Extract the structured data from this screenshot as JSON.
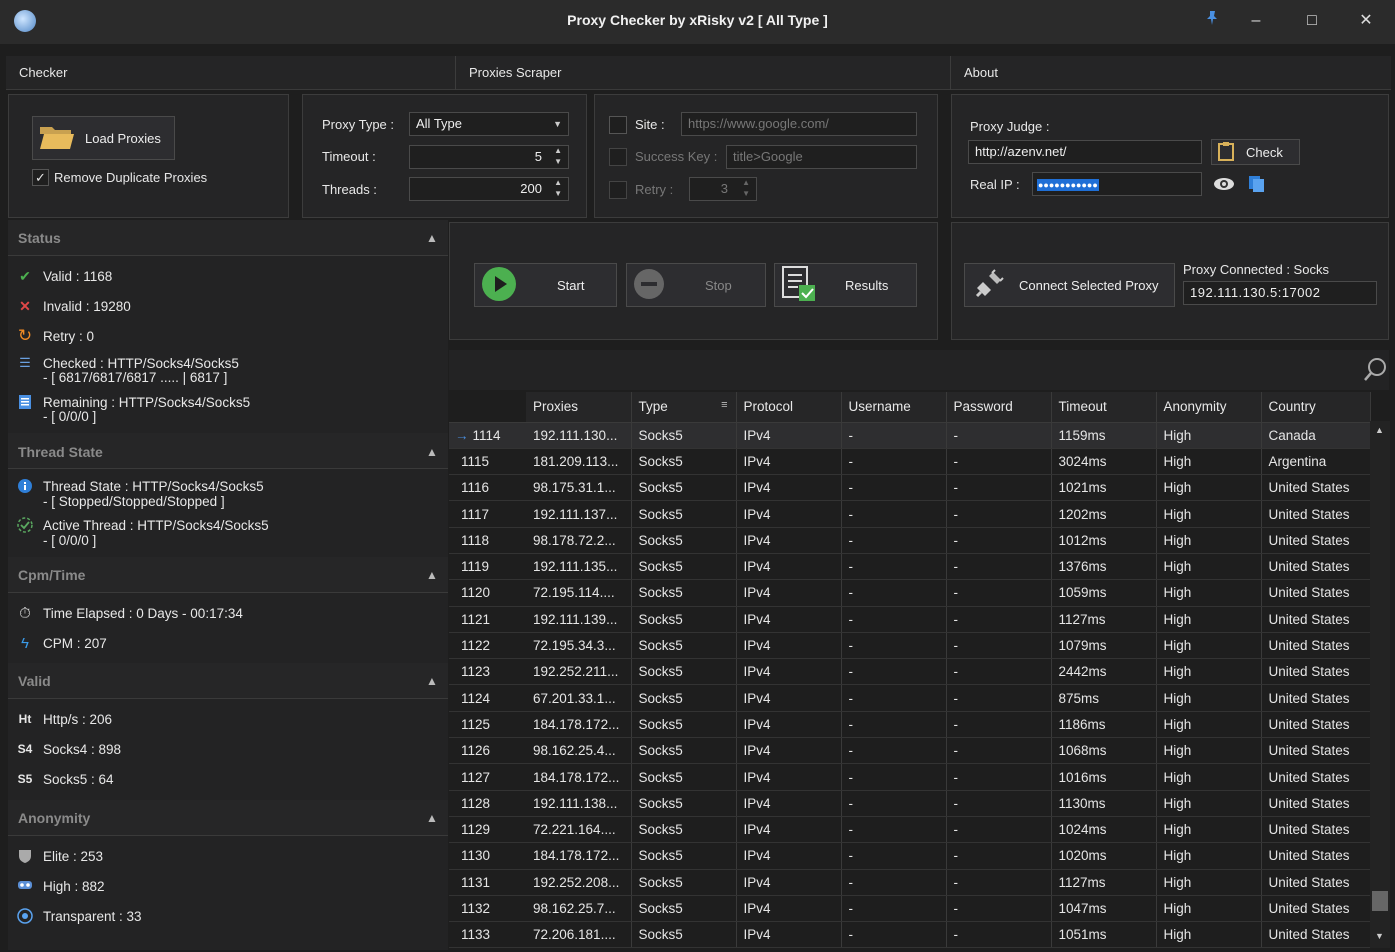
{
  "window": {
    "title": "Proxy Checker by xRisky v2 [ All Type ]",
    "pin": "pin-icon",
    "minimize": "–",
    "maximize": "□",
    "close": "✕"
  },
  "tabs": [
    "Checker",
    "Proxies Scraper",
    "About"
  ],
  "load": {
    "button": "Load Proxies",
    "remove_dup": "Remove Duplicate Proxies",
    "remove_dup_checked": true
  },
  "settings": {
    "proxy_type_label": "Proxy Type :",
    "proxy_type_value": "All Type",
    "timeout_label": "Timeout :",
    "timeout_value": "5",
    "threads_label": "Threads :",
    "threads_value": "200"
  },
  "site": {
    "site_label": "Site :",
    "site_placeholder": "https://www.google.com/",
    "success_label": "Success Key :",
    "success_placeholder": "title>Google",
    "retry_label": "Retry :",
    "retry_value": "3"
  },
  "judge": {
    "label": "Proxy Judge :",
    "value": "http://azenv.net/",
    "check": "Check",
    "real_ip_label": "Real IP :",
    "real_ip_value": "●●●●●●●●●●●"
  },
  "actions": {
    "start": "Start",
    "stop": "Stop",
    "results": "Results"
  },
  "connect": {
    "button": "Connect Selected Proxy",
    "connected_label": "Proxy Connected : Socks",
    "connected_value": "192.111.130.5:17002"
  },
  "status": {
    "title": "Status",
    "valid": "Valid : 1168",
    "invalid": "Invalid : 19280",
    "retry": "Retry : 0",
    "checked": "Checked : HTTP/Socks4/Socks5",
    "checked_sub": "- [ 6817/6817/6817 ..... | 6817 ]",
    "remaining": "Remaining : HTTP/Socks4/Socks5",
    "remaining_sub": "- [ 0/0/0 ]"
  },
  "thread": {
    "title": "Thread State",
    "state": "Thread State : HTTP/Socks4/Socks5",
    "state_sub": "- [ Stopped/Stopped/Stopped ]",
    "active": "Active Thread : HTTP/Socks4/Socks5",
    "active_sub": "- [ 0/0/0 ]"
  },
  "cpm": {
    "title": "Cpm/Time",
    "elapsed": "Time Elapsed : 0 Days - 00:17:34",
    "cpm": "CPM : 207"
  },
  "valid": {
    "title": "Valid",
    "http": "Http/s : 206",
    "socks4": "Socks4 : 898",
    "socks5": "Socks5 : 64"
  },
  "anon": {
    "title": "Anonymity",
    "elite": "Elite : 253",
    "high": "High : 882",
    "transparent": "Transparent : 33"
  },
  "grid": {
    "columns": [
      "",
      "Proxies",
      "Type",
      "Protocol",
      "Username",
      "Password",
      "Timeout",
      "Anonymity",
      "Country"
    ],
    "rows": [
      [
        "1114",
        "192.111.130...",
        "Socks5",
        "IPv4",
        "-",
        "-",
        "1159ms",
        "High",
        "Canada"
      ],
      [
        "1115",
        "181.209.113...",
        "Socks5",
        "IPv4",
        "-",
        "-",
        "3024ms",
        "High",
        "Argentina"
      ],
      [
        "1116",
        "98.175.31.1...",
        "Socks5",
        "IPv4",
        "-",
        "-",
        "1021ms",
        "High",
        "United States"
      ],
      [
        "1117",
        "192.111.137...",
        "Socks5",
        "IPv4",
        "-",
        "-",
        "1202ms",
        "High",
        "United States"
      ],
      [
        "1118",
        "98.178.72.2...",
        "Socks5",
        "IPv4",
        "-",
        "-",
        "1012ms",
        "High",
        "United States"
      ],
      [
        "1119",
        "192.111.135...",
        "Socks5",
        "IPv4",
        "-",
        "-",
        "1376ms",
        "High",
        "United States"
      ],
      [
        "1120",
        "72.195.114....",
        "Socks5",
        "IPv4",
        "-",
        "-",
        "1059ms",
        "High",
        "United States"
      ],
      [
        "1121",
        "192.111.139...",
        "Socks5",
        "IPv4",
        "-",
        "-",
        "1127ms",
        "High",
        "United States"
      ],
      [
        "1122",
        "72.195.34.3...",
        "Socks5",
        "IPv4",
        "-",
        "-",
        "1079ms",
        "High",
        "United States"
      ],
      [
        "1123",
        "192.252.211...",
        "Socks5",
        "IPv4",
        "-",
        "-",
        "2442ms",
        "High",
        "United States"
      ],
      [
        "1124",
        "67.201.33.1...",
        "Socks5",
        "IPv4",
        "-",
        "-",
        "875ms",
        "High",
        "United States"
      ],
      [
        "1125",
        "184.178.172...",
        "Socks5",
        "IPv4",
        "-",
        "-",
        "1186ms",
        "High",
        "United States"
      ],
      [
        "1126",
        "98.162.25.4...",
        "Socks5",
        "IPv4",
        "-",
        "-",
        "1068ms",
        "High",
        "United States"
      ],
      [
        "1127",
        "184.178.172...",
        "Socks5",
        "IPv4",
        "-",
        "-",
        "1016ms",
        "High",
        "United States"
      ],
      [
        "1128",
        "192.111.138...",
        "Socks5",
        "IPv4",
        "-",
        "-",
        "1130ms",
        "High",
        "United States"
      ],
      [
        "1129",
        "72.221.164....",
        "Socks5",
        "IPv4",
        "-",
        "-",
        "1024ms",
        "High",
        "United States"
      ],
      [
        "1130",
        "184.178.172...",
        "Socks5",
        "IPv4",
        "-",
        "-",
        "1020ms",
        "High",
        "United States"
      ],
      [
        "1131",
        "192.252.208...",
        "Socks5",
        "IPv4",
        "-",
        "-",
        "1127ms",
        "High",
        "United States"
      ],
      [
        "1132",
        "98.162.25.7...",
        "Socks5",
        "IPv4",
        "-",
        "-",
        "1047ms",
        "High",
        "United States"
      ],
      [
        "1133",
        "72.206.181....",
        "Socks5",
        "IPv4",
        "-",
        "-",
        "1051ms",
        "High",
        "United States"
      ]
    ]
  }
}
